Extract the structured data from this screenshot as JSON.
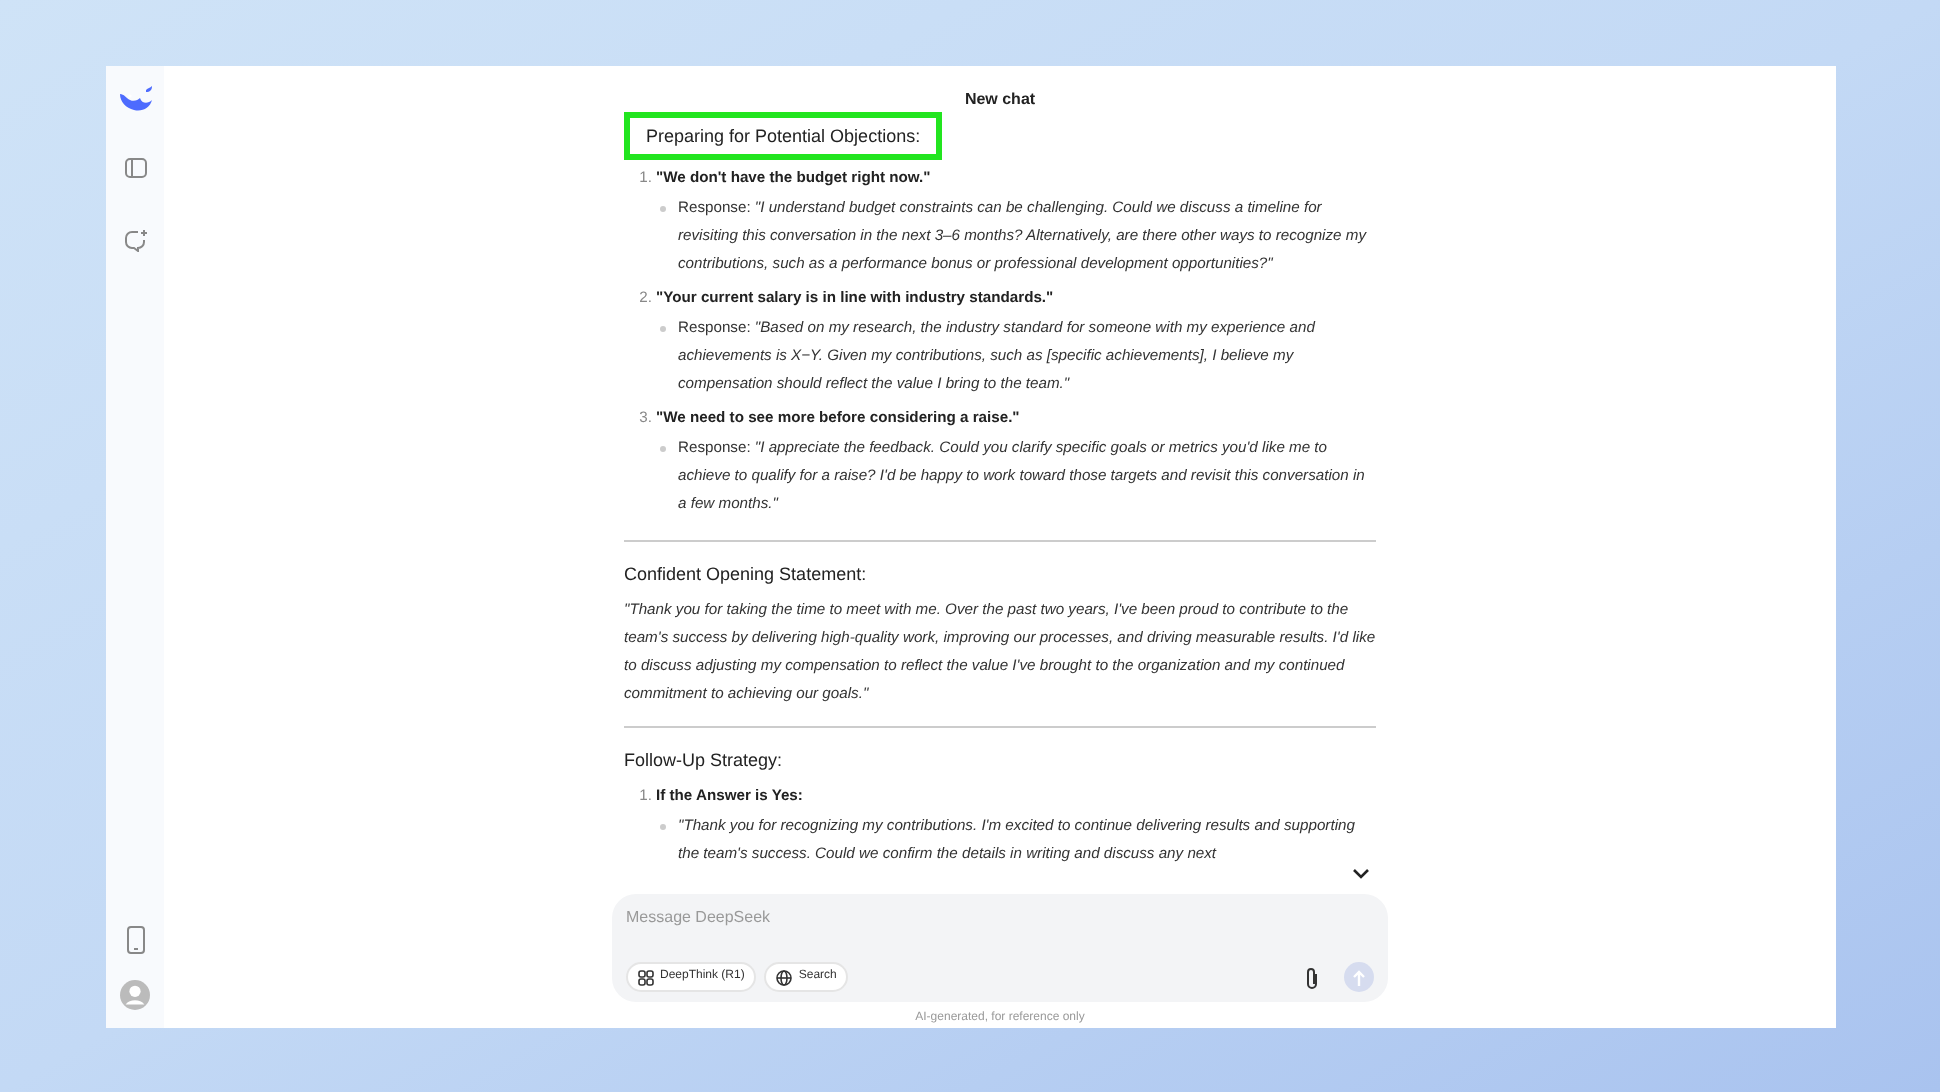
{
  "chat": {
    "title": "New chat"
  },
  "sections": [
    {
      "heading": "Preparing for Potential Objections:",
      "highlighted": true,
      "kind": "list",
      "items": [
        {
          "number": "1.",
          "title": "\"We don't have the budget right now.\"",
          "bullets": [
            "Response: *\"I understand budget constraints can be challenging. Could we discuss a timeline for revisiting this conversation in the next 3–6 months? Alternatively, are there other ways to recognize my contributions, such as a performance bonus or professional development opportunities?\"*"
          ]
        },
        {
          "number": "2.",
          "title": "\"Your current salary is in line with industry standards.\"",
          "bullets": [
            "Response: *\"Based on my research, the industry standard for someone with my experience and achievements is X−Y. Given my contributions, such as [specific achievements], I believe my compensation should reflect the value I bring to the team.\"*"
          ]
        },
        {
          "number": "3.",
          "title": "\"We need to see more before considering a raise.\"",
          "bullets": [
            "Response: *\"I appreciate the feedback. Could you clarify specific goals or metrics you'd like me to achieve to qualify for a raise? I'd be happy to work toward those targets and revisit this conversation in a few months.\"*"
          ]
        }
      ]
    },
    {
      "heading": "Confident Opening Statement:",
      "highlighted": false,
      "kind": "paragraph",
      "text": "\"Thank you for taking the time to meet with me. Over the past two years, I've been proud to contribute to the team's success by delivering high-quality work, improving our processes, and driving measurable results. I'd like to discuss adjusting my compensation to reflect the value I've brought to the organization and my continued commitment to achieving our goals.\""
    },
    {
      "heading": "Follow-Up Strategy:",
      "highlighted": false,
      "kind": "list",
      "items": [
        {
          "number": "1.",
          "title": "If the Answer is Yes:",
          "bullets": [
            "\"Thank you for recognizing my contributions. I'm excited to continue delivering results and supporting the team's success. Could we confirm the details in writing and discuss any next"
          ]
        }
      ]
    }
  ],
  "composer": {
    "placeholder": "Message DeepSeek",
    "buttons": [
      {
        "label": "DeepThink (R1)",
        "kind": "deepthink",
        "selected": false
      },
      {
        "label": "Search",
        "kind": "search",
        "selected": false
      }
    ]
  },
  "footer": "AI-generated, for reference only"
}
